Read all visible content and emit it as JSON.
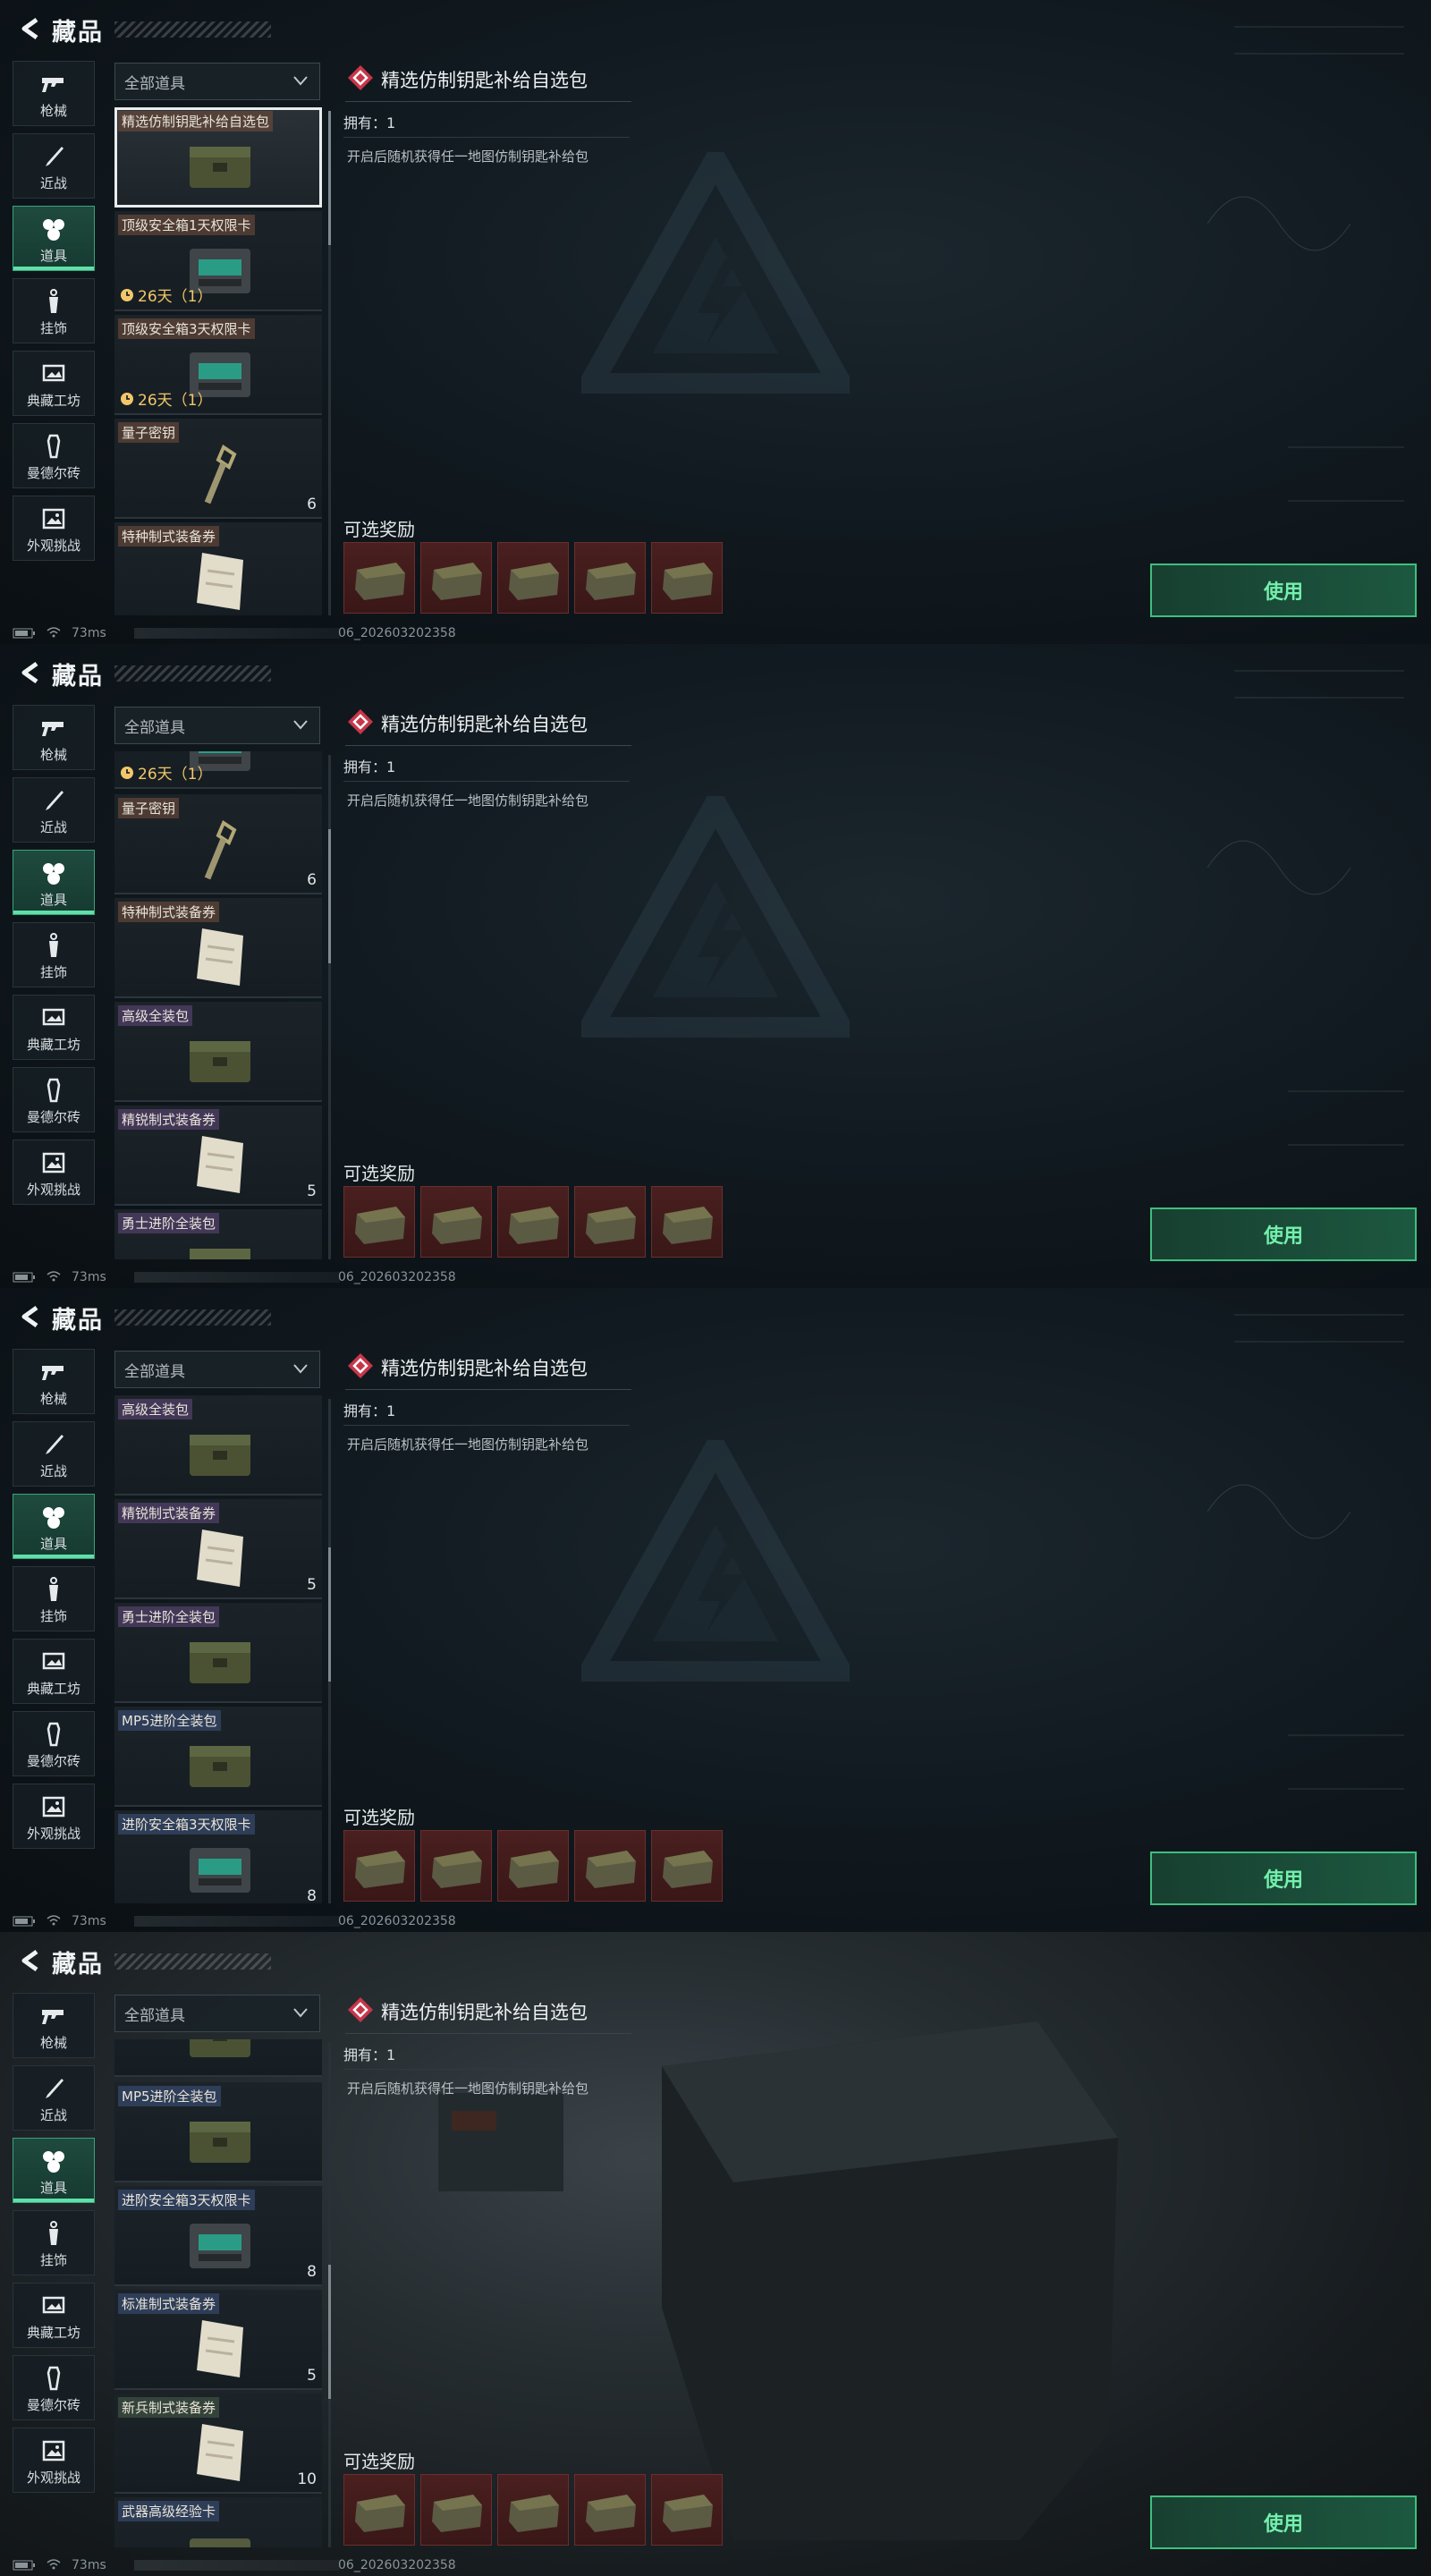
{
  "page": {
    "title": "藏品"
  },
  "sidebar": {
    "items": [
      {
        "label": "枪械",
        "icon": "gun-icon"
      },
      {
        "label": "近战",
        "icon": "knife-icon"
      },
      {
        "label": "道具",
        "icon": "items-icon",
        "active": true
      },
      {
        "label": "挂饰",
        "icon": "charm-icon"
      },
      {
        "label": "典藏工坊",
        "icon": "workshop-icon"
      },
      {
        "label": "曼德尔砖",
        "icon": "brick-icon"
      },
      {
        "label": "外观挑战",
        "icon": "image-icon"
      }
    ]
  },
  "filter": {
    "label": "全部道具"
  },
  "detail": {
    "title": "精选仿制钥匙补给自选包",
    "owned_label": "拥有：",
    "owned_value": "1",
    "description": "开启后随机获得任一地图仿制钥匙补给包",
    "rewards_title": "可选奖励",
    "reward_count": 5,
    "use_button": "使用"
  },
  "status": {
    "ping": "73ms",
    "build": "06_202603202358"
  },
  "colors": {
    "accent": "#5fe0a8",
    "timer": "#f2c76a",
    "reward_bg": "#4a1f1f"
  },
  "panels": [
    {
      "scroll": 0.0,
      "photo": false,
      "cards": [
        {
          "name": "精选仿制钥匙补给自选包",
          "tagc": "",
          "selected": true,
          "icon": "crate-icon"
        },
        {
          "name": "顶级安全箱1天权限卡",
          "tagc": "",
          "timer": "26天（1）",
          "icon": "safe-card-icon"
        },
        {
          "name": "顶级安全箱3天权限卡",
          "tagc": "",
          "timer": "26天（1）",
          "icon": "safe-card-icon"
        },
        {
          "name": "量子密钥",
          "tagc": "",
          "count": "6",
          "icon": "key-icon"
        },
        {
          "name": "特种制式装备券",
          "tagc": "",
          "icon": "voucher-icon"
        }
      ]
    },
    {
      "scroll": 0.15,
      "photo": false,
      "cards": [
        {
          "name": "",
          "timer": "26天（1）",
          "icon": "safe-card-icon",
          "partial": true
        },
        {
          "name": "量子密钥",
          "tagc": "",
          "count": "6",
          "icon": "key-icon"
        },
        {
          "name": "特种制式装备券",
          "tagc": "",
          "icon": "voucher-icon"
        },
        {
          "name": "高级全装包",
          "tagc": "purple",
          "icon": "crate-icon"
        },
        {
          "name": "精锐制式装备券",
          "tagc": "purple",
          "count": "5",
          "icon": "voucher-icon"
        },
        {
          "name": "勇士进阶全装包",
          "tagc": "purple",
          "icon": "crate-icon"
        }
      ]
    },
    {
      "scroll": 0.3,
      "photo": false,
      "cards": [
        {
          "name": "高级全装包",
          "tagc": "purple",
          "icon": "crate-icon"
        },
        {
          "name": "精锐制式装备券",
          "tagc": "purple",
          "count": "5",
          "icon": "voucher-icon"
        },
        {
          "name": "勇士进阶全装包",
          "tagc": "purple",
          "icon": "crate-icon"
        },
        {
          "name": "MP5进阶全装包",
          "tagc": "blue",
          "icon": "crate-icon"
        },
        {
          "name": "进阶安全箱3天权限卡",
          "tagc": "blue",
          "count": "8",
          "icon": "safe-card-icon"
        }
      ]
    },
    {
      "scroll": 0.45,
      "photo": true,
      "cards": [
        {
          "name": "",
          "icon": "crate-icon",
          "partial": true
        },
        {
          "name": "MP5进阶全装包",
          "tagc": "blue",
          "icon": "crate-icon"
        },
        {
          "name": "进阶安全箱3天权限卡",
          "tagc": "blue",
          "count": "8",
          "icon": "safe-card-icon"
        },
        {
          "name": "标准制式装备券",
          "tagc": "blue",
          "count": "5",
          "icon": "voucher-icon"
        },
        {
          "name": "新兵制式装备券",
          "tagc": "green",
          "count": "10",
          "icon": "voucher-icon"
        },
        {
          "name": "武器高级经验卡",
          "tagc": "blue",
          "icon": "exp-card-icon"
        }
      ]
    }
  ]
}
